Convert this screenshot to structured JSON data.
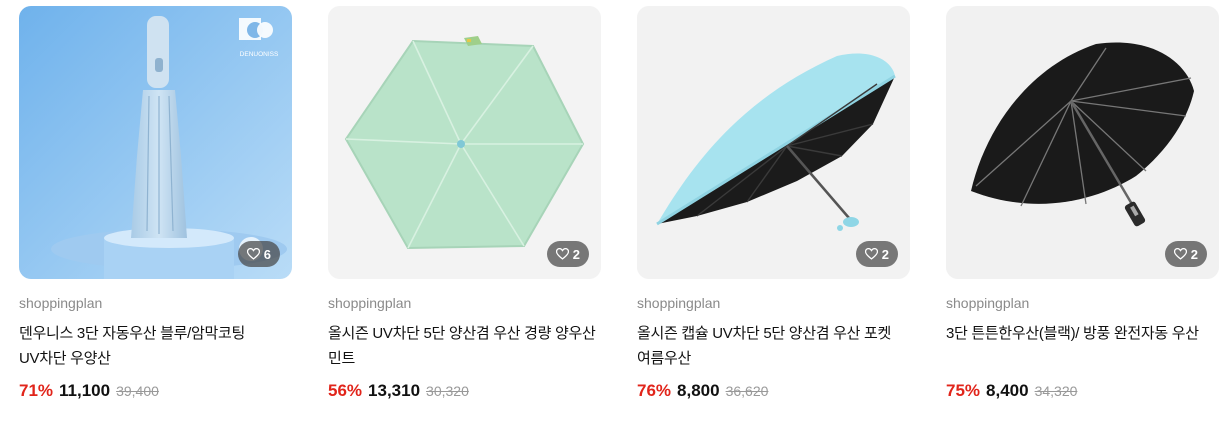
{
  "products": [
    {
      "seller": "shoppingplan",
      "title": "덴우니스 3단 자동우산 블루/암막코팅 UV차단 우양산",
      "discount": "71%",
      "price": "11,100",
      "original_price": "39,400",
      "likes": "6",
      "brand_logo_text": "DENUONISS",
      "image": "light-blue-folded-umbrella"
    },
    {
      "seller": "shoppingplan",
      "title": "올시즌 UV차단 5단 양산겸 우산 경량 양우산 민트",
      "discount": "56%",
      "price": "13,310",
      "original_price": "30,320",
      "likes": "2",
      "image": "mint-open-umbrella-top-view"
    },
    {
      "seller": "shoppingplan",
      "title": "올시즌 캡슐 UV차단 5단 양산겸 우산 포켓 여름우산",
      "discount": "76%",
      "price": "8,800",
      "original_price": "36,620",
      "likes": "2",
      "image": "sky-blue-open-umbrella-black-lining"
    },
    {
      "seller": "shoppingplan",
      "title": "3단 튼튼한우산(블랙)/ 방풍 완전자동 우산",
      "discount": "75%",
      "price": "8,400",
      "original_price": "34,320",
      "likes": "2",
      "image": "black-open-umbrella"
    }
  ],
  "colors": {
    "discount": "#e1251b",
    "seller": "#8a8a8a",
    "strike": "#999999"
  }
}
